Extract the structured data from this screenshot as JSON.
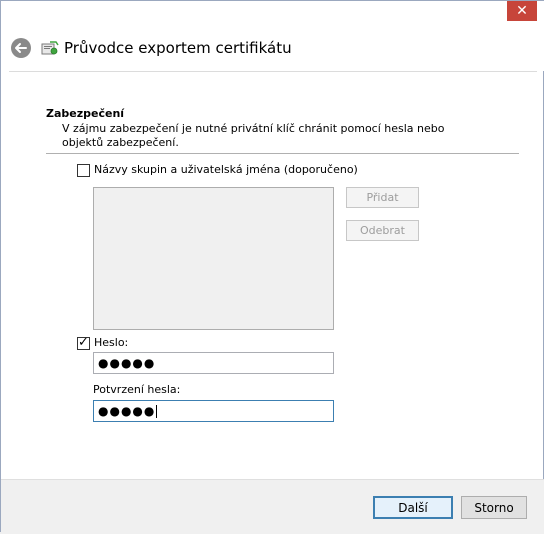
{
  "window": {
    "close_glyph": "✕",
    "title": "Průvodce exportem certifikátu"
  },
  "section": {
    "title": "Zabezpečení",
    "description": "V zájmu zabezpečení je nutné privátní klíč chránit pomocí hesla nebo objektů zabezpečení."
  },
  "groups": {
    "checkbox_label": "Názvy skupin a uživatelská jména (doporučeno)",
    "checked": false,
    "add_label": "Přidat",
    "remove_label": "Odebrat",
    "items": []
  },
  "password": {
    "checkbox_label": "Heslo:",
    "checked": true,
    "value": "●●●●●",
    "confirm_label": "Potvrzení hesla:",
    "confirm_value": "●●●●●"
  },
  "footer": {
    "next_label": "Další",
    "cancel_label": "Storno"
  },
  "colors": {
    "close_bg": "#c7453a",
    "accent": "#3c7fb1"
  },
  "icons": {
    "close": "close-icon",
    "back": "back-arrow-icon",
    "wizard": "certificate-wizard-icon"
  }
}
